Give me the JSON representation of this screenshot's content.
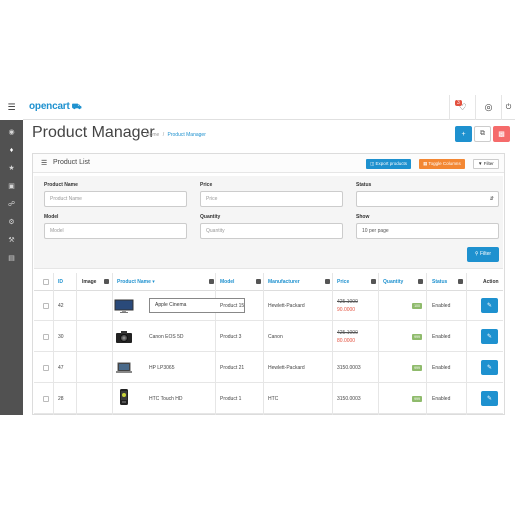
{
  "header": {
    "logo": "opencart",
    "notification_count": "3"
  },
  "page": {
    "title": "Product Manager",
    "breadcrumb": [
      "Home",
      "Product Manager"
    ]
  },
  "panel": {
    "title": "Product List",
    "export_label": "Export products",
    "toggle_label": "Toggle Columns",
    "filter_label": "Filter"
  },
  "filter": {
    "product_name": {
      "label": "Product Name",
      "placeholder": "Product Name"
    },
    "price": {
      "label": "Price",
      "placeholder": "Price"
    },
    "status": {
      "label": "Status",
      "value": ""
    },
    "model": {
      "label": "Model",
      "placeholder": "Model"
    },
    "quantity": {
      "label": "Quantity",
      "placeholder": "Quantity"
    },
    "show": {
      "label": "Show",
      "value": "10 per page"
    },
    "submit_label": "Filter"
  },
  "table": {
    "columns": [
      "ID",
      "Image",
      "Product Name",
      "Model",
      "Manufacturer",
      "Price",
      "Quantity",
      "Status",
      "Action"
    ],
    "rows": [
      {
        "id": "42",
        "image": "monitor",
        "name": "Apple Cinema",
        "model": "Product 15",
        "manufacturer": "Hewlett-Packard",
        "price": "425.1000",
        "special": "90.0000",
        "quantity": "100",
        "status": "Enabled"
      },
      {
        "id": "30",
        "image": "camera",
        "name": "Canon EOS 5D",
        "model": "Product 3",
        "manufacturer": "Canon",
        "price": "425.1000",
        "special": "80.0000",
        "quantity": "999",
        "status": "Enabled"
      },
      {
        "id": "47",
        "image": "laptop",
        "name": "HP LP3065",
        "model": "Product 21",
        "manufacturer": "Hewlett-Packard",
        "price": "3150.0003",
        "special": "",
        "quantity": "999",
        "status": "Enabled"
      },
      {
        "id": "28",
        "image": "phone",
        "name": "HTC Touch HD",
        "model": "Product 1",
        "manufacturer": "HTC",
        "price": "3150.0003",
        "special": "",
        "quantity": "999",
        "status": "Enabled"
      }
    ]
  },
  "colors": {
    "primary": "#1e91cf",
    "danger": "#e3503e",
    "warning": "#f38733",
    "success": "#8fbb6c",
    "sidebar": "#515151"
  }
}
